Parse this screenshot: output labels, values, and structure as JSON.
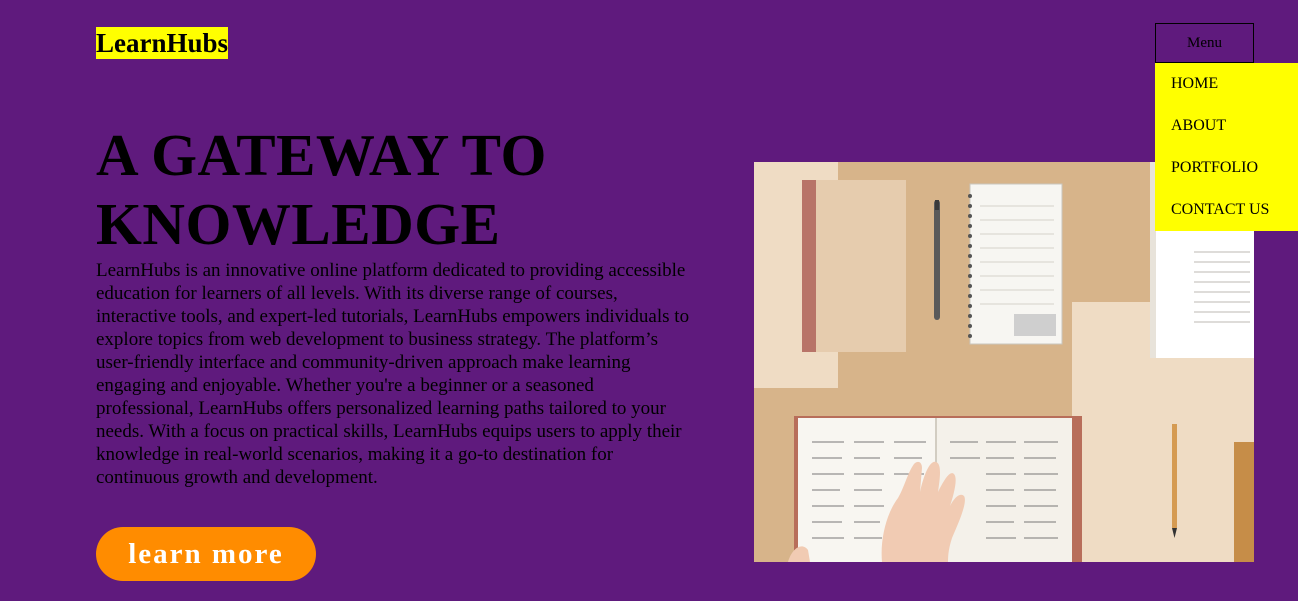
{
  "header": {
    "logo": "LearnHubs",
    "menu_button_label": "Menu"
  },
  "nav": {
    "items": [
      {
        "label": "HOME"
      },
      {
        "label": "ABOUT"
      },
      {
        "label": "PORTFOLIO"
      },
      {
        "label": "CONTACT US"
      }
    ]
  },
  "hero": {
    "title": "A GATEWAY TO KNOWLEDGE",
    "description": "LearnHubs is an innovative online platform dedicated to providing accessible education for learners of all levels. With its diverse range of courses, interactive tools, and expert-led tutorials, LearnHubs empowers individuals to explore topics from web development to business strategy. The platform’s user-friendly interface and community-driven approach make learning engaging and enjoyable. Whether you're a beginner or a seasoned professional, LearnHubs offers personalized learning paths tailored to your needs. With a focus on practical skills, LearnHubs equips users to apply their knowledge in real-world scenarios, making it a go-to destination for continuous growth and development.",
    "cta_label": "learn more"
  },
  "colors": {
    "background": "#5f1a7d",
    "highlight": "#ffff00",
    "cta": "#ff8c00"
  }
}
